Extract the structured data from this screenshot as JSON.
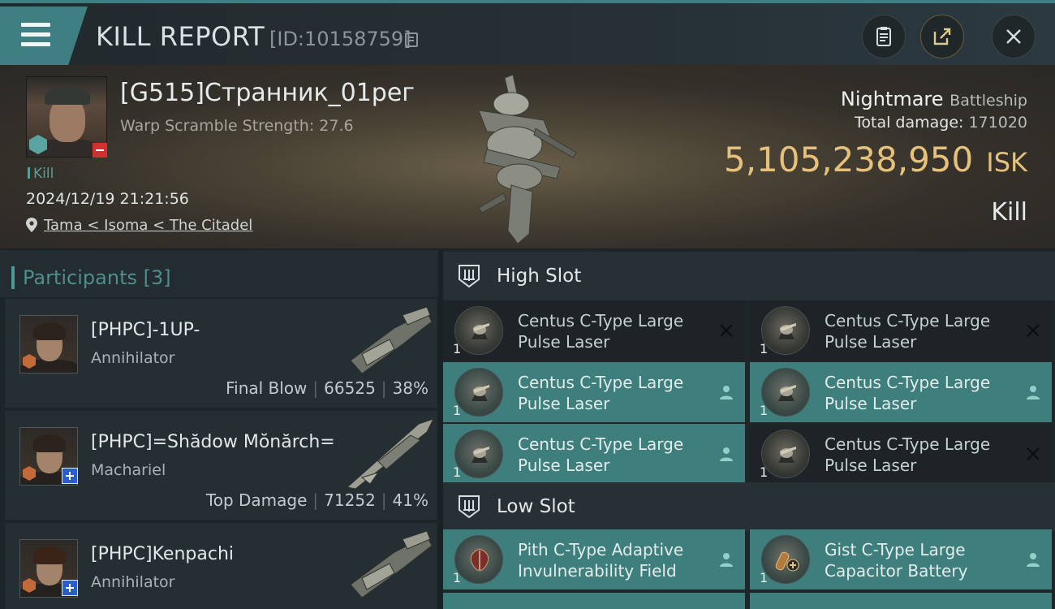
{
  "header": {
    "title": "KILL REPORT",
    "report_id": "[ID:10158759]"
  },
  "victim": {
    "name": "[G515]Странник_01рег",
    "scramble": "Warp Scramble Strength: 27.6",
    "kill_tag": "Kill",
    "timestamp": "2024/12/19 21:21:56",
    "location": "Tama < Isoma < The Citadel",
    "ship_name": "Nightmare",
    "ship_class": "Battleship",
    "total_damage_label": "Total damage:",
    "total_damage": "171020",
    "isk_value": "5,105,238,950",
    "isk_unit": "ISK",
    "result": "Kill"
  },
  "participants": {
    "title": "Participants [3]",
    "rows": [
      {
        "name": "[PHPC]-1UP-",
        "ship": "Annihilator",
        "tag": "Final Blow",
        "damage": "66525",
        "percent": "38%",
        "has_plus": false
      },
      {
        "name": "[PHPC]=Shădow Mŏnărch=",
        "ship": "Machariel",
        "tag": "Top Damage",
        "damage": "71252",
        "percent": "41%",
        "has_plus": true
      },
      {
        "name": "[PHPC]Kenpachi",
        "ship": "Annihilator",
        "tag": "",
        "damage": "",
        "percent": "",
        "has_plus": true
      }
    ]
  },
  "fitting": {
    "high_slot_label": "High Slot",
    "low_slot_label": "Low Slot",
    "high_slot": [
      {
        "name_line1": "Centus C-Type Large",
        "name_line2": "Pulse Laser",
        "qty": "1",
        "state": "destroyed"
      },
      {
        "name_line1": "Centus C-Type Large",
        "name_line2": "Pulse Laser",
        "qty": "1",
        "state": "destroyed"
      },
      {
        "name_line1": "Centus C-Type Large",
        "name_line2": "Pulse Laser",
        "qty": "1",
        "state": "dropped"
      },
      {
        "name_line1": "Centus C-Type Large",
        "name_line2": "Pulse Laser",
        "qty": "1",
        "state": "dropped"
      },
      {
        "name_line1": "Centus C-Type Large",
        "name_line2": "Pulse Laser",
        "qty": "1",
        "state": "dropped"
      },
      {
        "name_line1": "Centus C-Type Large",
        "name_line2": "Pulse Laser",
        "qty": "1",
        "state": "destroyed"
      }
    ],
    "low_slot": [
      {
        "name_line1": "Pith C-Type Adaptive",
        "name_line2": "Invulnerability Field",
        "qty": "1",
        "state": "dropped"
      },
      {
        "name_line1": "Gist C-Type Large",
        "name_line2": "Capacitor Battery",
        "qty": "1",
        "state": "dropped"
      }
    ]
  },
  "icons": {
    "menu": "hamburger-icon",
    "copy": "copy-icon",
    "clipboard": "clipboard-icon",
    "share": "share-icon",
    "close": "close-icon",
    "location": "location-pin-icon",
    "destroyed": "x-icon",
    "dropped": "person-icon"
  },
  "colors": {
    "accent_teal": "#3e7f7d",
    "isk_gold": "#e6c17b",
    "danger_red": "#d0302e"
  }
}
